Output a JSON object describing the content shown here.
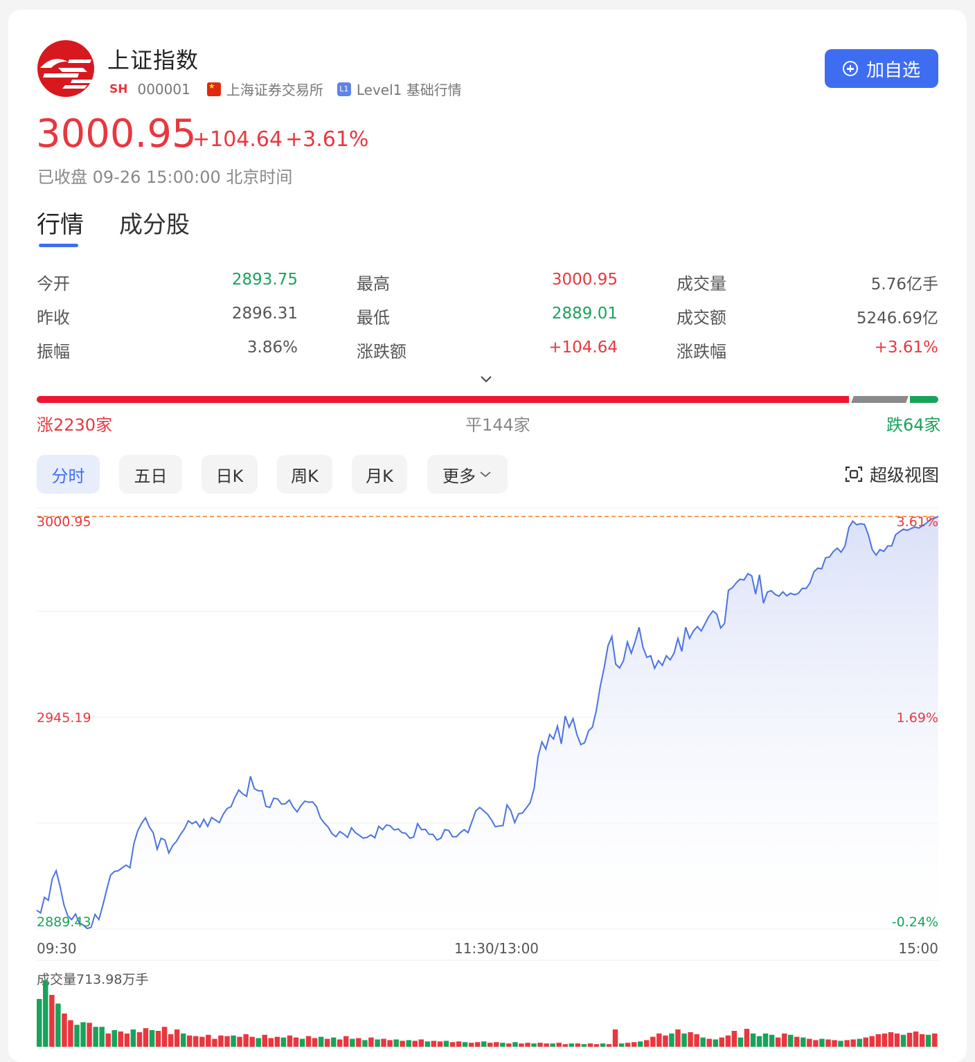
{
  "header": {
    "title": "上证指数",
    "market_tag": "SH",
    "code": "000001",
    "exchange": "上海证券交易所",
    "level_badge": "L1",
    "level_text": "Level1 基础行情",
    "add_button": "加自选"
  },
  "quote": {
    "price": "3000.95",
    "change": "+104.64",
    "change_pct": "+3.61%",
    "status": "已收盘 09-26 15:00:00 北京时间"
  },
  "tabs": [
    "行情",
    "成分股"
  ],
  "stats": [
    [
      {
        "label": "今开",
        "value": "2893.75",
        "color": "green"
      },
      {
        "label": "最高",
        "value": "3000.95",
        "color": "red"
      },
      {
        "label": "成交量",
        "value": "5.76亿手",
        "color": "gray"
      }
    ],
    [
      {
        "label": "昨收",
        "value": "2896.31",
        "color": "gray"
      },
      {
        "label": "最低",
        "value": "2889.01",
        "color": "green"
      },
      {
        "label": "成交额",
        "value": "5246.69亿",
        "color": "gray"
      }
    ],
    [
      {
        "label": "振幅",
        "value": "3.86%",
        "color": "gray"
      },
      {
        "label": "涨跌额",
        "value": "+104.64",
        "color": "red"
      },
      {
        "label": "涨跌幅",
        "value": "+3.61%",
        "color": "red"
      }
    ]
  ],
  "breadth": {
    "up": "涨2230家",
    "flat": "平144家",
    "down": "跌64家",
    "up_count": 2230,
    "flat_count": 144,
    "down_count": 64
  },
  "chart_tabs": [
    "分时",
    "五日",
    "日K",
    "周K",
    "月K",
    "更多"
  ],
  "super_view": "超级视图",
  "colors": {
    "up": "#e8373f",
    "down": "#19a35a",
    "accent": "#3e6df2",
    "line": "#4a72e0"
  },
  "chart_data": {
    "type": "line",
    "prev_close": 2896.31,
    "ylim": [
      2889.43,
      3000.95
    ],
    "y_labels_left": [
      "3000.95",
      "2945.19",
      "2889.43"
    ],
    "y_labels_right": [
      "3.61%",
      "1.69%",
      "-0.24%"
    ],
    "x_labels": [
      "09:30",
      "11:30/13:00",
      "15:00"
    ],
    "series": [
      {
        "values": [
          2894.5,
          2893.8,
          2898,
          2897.2,
          2903,
          2905.2,
          2901,
          2896,
          2893,
          2892,
          2893.5,
          2891,
          2890.5,
          2889.6,
          2889.9,
          2893.4,
          2892,
          2895.8,
          2900,
          2904,
          2905,
          2905.2,
          2906,
          2906.7,
          2906,
          2912.5,
          2916,
          2918,
          2919.5,
          2917,
          2915.4,
          2911,
          2914,
          2913.5,
          2910,
          2912,
          2913.2,
          2915,
          2916.5,
          2918.7,
          2917.9,
          2918.5,
          2917,
          2919.1,
          2917.2,
          2919.6,
          2918.9,
          2918.2,
          2920.5,
          2922,
          2922.5,
          2925,
          2927,
          2926,
          2925.3,
          2930.7,
          2927.4,
          2926.8,
          2926.8,
          2922.6,
          2922.3,
          2924.8,
          2924.6,
          2923.2,
          2923.3,
          2924.3,
          2922.4,
          2921.1,
          2922.8,
          2924,
          2923.7,
          2923.8,
          2922.5,
          2919.5,
          2918.1,
          2917,
          2915.2,
          2914.4,
          2915.8,
          2915.1,
          2914.2,
          2916.8,
          2915.5,
          2914.8,
          2914,
          2914.2,
          2914.9,
          2914.1,
          2917.2,
          2916.3,
          2917.6,
          2917.3,
          2916.2,
          2916.5,
          2915.5,
          2915.3,
          2914,
          2914.3,
          2917.9,
          2916.3,
          2916.4,
          2915,
          2915,
          2913.5,
          2914,
          2916.3,
          2916.1,
          2914.4,
          2914.4,
          2915.5,
          2916.3,
          2915.5,
          2918.5,
          2921.4,
          2922.3,
          2921.4,
          2920.5,
          2919,
          2917.1,
          2917.3,
          2917.4,
          2923,
          2921.4,
          2918.2,
          2920.6,
          2920.8,
          2922.2,
          2923.6,
          2927.4,
          2936,
          2940,
          2938.1,
          2942,
          2940.8,
          2944.3,
          2939.5,
          2947,
          2944,
          2946.3,
          2942,
          2939.3,
          2939.8,
          2943,
          2944,
          2948.5,
          2955,
          2960,
          2966,
          2968.5,
          2961,
          2960,
          2962,
          2967,
          2964,
          2967.2,
          2971,
          2965.6,
          2962.9,
          2963.3,
          2959.9,
          2962,
          2960.7,
          2963.3,
          2962.2,
          2964,
          2968,
          2964.5,
          2971,
          2968,
          2970,
          2971.2,
          2970,
          2972,
          2974,
          2975.4,
          2974.6,
          2970.8,
          2972,
          2981,
          2981.7,
          2983,
          2984,
          2983.8,
          2985.5,
          2984.9,
          2980,
          2985.2,
          2977.5,
          2980.5,
          2980.9,
          2979.9,
          2979.4,
          2980.6,
          2979.5,
          2980.2,
          2979.8,
          2980.2,
          2981.5,
          2981.5,
          2983,
          2986,
          2987,
          2986.8,
          2989.8,
          2990,
          2991.5,
          2992.4,
          2991.3,
          2993,
          2998,
          2999.7,
          2998.7,
          2999,
          2998.8,
          2996,
          2992,
          2990.5,
          2992,
          2991.5,
          2993,
          2993,
          2996,
          2996.8,
          2997.5,
          2997.2,
          2997.7,
          2998.1,
          2997.8,
          2998.5,
          2999.2,
          3000.2,
          3000.5,
          3000.95
        ]
      }
    ],
    "volume_title": "成交量713.98万手",
    "volume": [
      {
        "v": 0.72,
        "d": "u"
      },
      {
        "v": 1,
        "d": "u"
      },
      {
        "v": 0.78,
        "d": "d"
      },
      {
        "v": 0.65,
        "d": "u"
      },
      {
        "v": 0.5,
        "d": "d"
      },
      {
        "v": 0.4,
        "d": "d"
      },
      {
        "v": 0.33,
        "d": "u"
      },
      {
        "v": 0.37,
        "d": "u"
      },
      {
        "v": 0.36,
        "d": "d"
      },
      {
        "v": 0.3,
        "d": "u"
      },
      {
        "v": 0.3,
        "d": "u"
      },
      {
        "v": 0.2,
        "d": "d"
      },
      {
        "v": 0.25,
        "d": "u"
      },
      {
        "v": 0.23,
        "d": "d"
      },
      {
        "v": 0.2,
        "d": "d"
      },
      {
        "v": 0.26,
        "d": "u"
      },
      {
        "v": 0.22,
        "d": "d"
      },
      {
        "v": 0.28,
        "d": "d"
      },
      {
        "v": 0.25,
        "d": "u"
      },
      {
        "v": 0.24,
        "d": "d"
      },
      {
        "v": 0.3,
        "d": "d"
      },
      {
        "v": 0.19,
        "d": "d"
      },
      {
        "v": 0.26,
        "d": "d"
      },
      {
        "v": 0.2,
        "d": "u"
      },
      {
        "v": 0.17,
        "d": "d"
      },
      {
        "v": 0.16,
        "d": "d"
      },
      {
        "v": 0.15,
        "d": "d"
      },
      {
        "v": 0.18,
        "d": "d"
      },
      {
        "v": 0.12,
        "d": "d"
      },
      {
        "v": 0.17,
        "d": "d"
      },
      {
        "v": 0.16,
        "d": "d"
      },
      {
        "v": 0.17,
        "d": "u"
      },
      {
        "v": 0.15,
        "d": "d"
      },
      {
        "v": 0.19,
        "d": "d"
      },
      {
        "v": 0.15,
        "d": "d"
      },
      {
        "v": 0.13,
        "d": "u"
      },
      {
        "v": 0.18,
        "d": "d"
      },
      {
        "v": 0.13,
        "d": "d"
      },
      {
        "v": 0.15,
        "d": "d"
      },
      {
        "v": 0.14,
        "d": "u"
      },
      {
        "v": 0.17,
        "d": "d"
      },
      {
        "v": 0.14,
        "d": "d"
      },
      {
        "v": 0.12,
        "d": "u"
      },
      {
        "v": 0.16,
        "d": "d"
      },
      {
        "v": 0.13,
        "d": "d"
      },
      {
        "v": 0.15,
        "d": "u"
      },
      {
        "v": 0.12,
        "d": "d"
      },
      {
        "v": 0.14,
        "d": "u"
      },
      {
        "v": 0.11,
        "d": "d"
      },
      {
        "v": 0.16,
        "d": "d"
      },
      {
        "v": 0.12,
        "d": "u"
      },
      {
        "v": 0.13,
        "d": "d"
      },
      {
        "v": 0.1,
        "d": "u"
      },
      {
        "v": 0.14,
        "d": "d"
      },
      {
        "v": 0.11,
        "d": "u"
      },
      {
        "v": 0.12,
        "d": "d"
      },
      {
        "v": 0.1,
        "d": "d"
      },
      {
        "v": 0.11,
        "d": "u"
      },
      {
        "v": 0.09,
        "d": "d"
      },
      {
        "v": 0.1,
        "d": "u"
      },
      {
        "v": 0.09,
        "d": "d"
      },
      {
        "v": 0.11,
        "d": "d"
      },
      {
        "v": 0.08,
        "d": "u"
      },
      {
        "v": 0.09,
        "d": "d"
      },
      {
        "v": 0.08,
        "d": "d"
      },
      {
        "v": 0.09,
        "d": "u"
      },
      {
        "v": 0.07,
        "d": "d"
      },
      {
        "v": 0.08,
        "d": "d"
      },
      {
        "v": 0.07,
        "d": "u"
      },
      {
        "v": 0.06,
        "d": "d"
      },
      {
        "v": 0.07,
        "d": "d"
      },
      {
        "v": 0.08,
        "d": "u"
      },
      {
        "v": 0.06,
        "d": "d"
      },
      {
        "v": 0.07,
        "d": "d"
      },
      {
        "v": 0.06,
        "d": "u"
      },
      {
        "v": 0.05,
        "d": "d"
      },
      {
        "v": 0.07,
        "d": "u"
      },
      {
        "v": 0.05,
        "d": "d"
      },
      {
        "v": 0.06,
        "d": "d"
      },
      {
        "v": 0.05,
        "d": "u"
      },
      {
        "v": 0.06,
        "d": "d"
      },
      {
        "v": 0.05,
        "d": "d"
      },
      {
        "v": 0.05,
        "d": "u"
      },
      {
        "v": 0.06,
        "d": "d"
      },
      {
        "v": 0.04,
        "d": "d"
      },
      {
        "v": 0.05,
        "d": "u"
      },
      {
        "v": 0.05,
        "d": "d"
      },
      {
        "v": 0.04,
        "d": "u"
      },
      {
        "v": 0.05,
        "d": "d"
      },
      {
        "v": 0.04,
        "d": "d"
      },
      {
        "v": 0.05,
        "d": "u"
      },
      {
        "v": 0.04,
        "d": "d"
      },
      {
        "v": 0.26,
        "d": "d"
      },
      {
        "v": 0.05,
        "d": "u"
      },
      {
        "v": 0.06,
        "d": "d"
      },
      {
        "v": 0.07,
        "d": "d"
      },
      {
        "v": 0.08,
        "d": "u"
      },
      {
        "v": 0.1,
        "d": "d"
      },
      {
        "v": 0.15,
        "d": "d"
      },
      {
        "v": 0.2,
        "d": "d"
      },
      {
        "v": 0.17,
        "d": "d"
      },
      {
        "v": 0.2,
        "d": "u"
      },
      {
        "v": 0.26,
        "d": "d"
      },
      {
        "v": 0.2,
        "d": "u"
      },
      {
        "v": 0.22,
        "d": "d"
      },
      {
        "v": 0.19,
        "d": "d"
      },
      {
        "v": 0.14,
        "d": "u"
      },
      {
        "v": 0.12,
        "d": "d"
      },
      {
        "v": 0.11,
        "d": "u"
      },
      {
        "v": 0.14,
        "d": "d"
      },
      {
        "v": 0.17,
        "d": "d"
      },
      {
        "v": 0.24,
        "d": "d"
      },
      {
        "v": 0.14,
        "d": "u"
      },
      {
        "v": 0.27,
        "d": "d"
      },
      {
        "v": 0.2,
        "d": "u"
      },
      {
        "v": 0.16,
        "d": "u"
      },
      {
        "v": 0.2,
        "d": "u"
      },
      {
        "v": 0.18,
        "d": "u"
      },
      {
        "v": 0.14,
        "d": "d"
      },
      {
        "v": 0.2,
        "d": "d"
      },
      {
        "v": 0.18,
        "d": "u"
      },
      {
        "v": 0.15,
        "d": "d"
      },
      {
        "v": 0.14,
        "d": "u"
      },
      {
        "v": 0.12,
        "d": "d"
      },
      {
        "v": 0.1,
        "d": "d"
      },
      {
        "v": 0.12,
        "d": "u"
      },
      {
        "v": 0.11,
        "d": "d"
      },
      {
        "v": 0.1,
        "d": "d"
      },
      {
        "v": 0.09,
        "d": "u"
      },
      {
        "v": 0.1,
        "d": "d"
      },
      {
        "v": 0.11,
        "d": "d"
      },
      {
        "v": 0.12,
        "d": "u"
      },
      {
        "v": 0.14,
        "d": "d"
      },
      {
        "v": 0.16,
        "d": "d"
      },
      {
        "v": 0.19,
        "d": "d"
      },
      {
        "v": 0.2,
        "d": "d"
      },
      {
        "v": 0.22,
        "d": "d"
      },
      {
        "v": 0.2,
        "d": "d"
      },
      {
        "v": 0.18,
        "d": "u"
      },
      {
        "v": 0.21,
        "d": "d"
      },
      {
        "v": 0.23,
        "d": "d"
      },
      {
        "v": 0.19,
        "d": "d"
      },
      {
        "v": 0.18,
        "d": "u"
      },
      {
        "v": 0.2,
        "d": "d"
      }
    ]
  }
}
